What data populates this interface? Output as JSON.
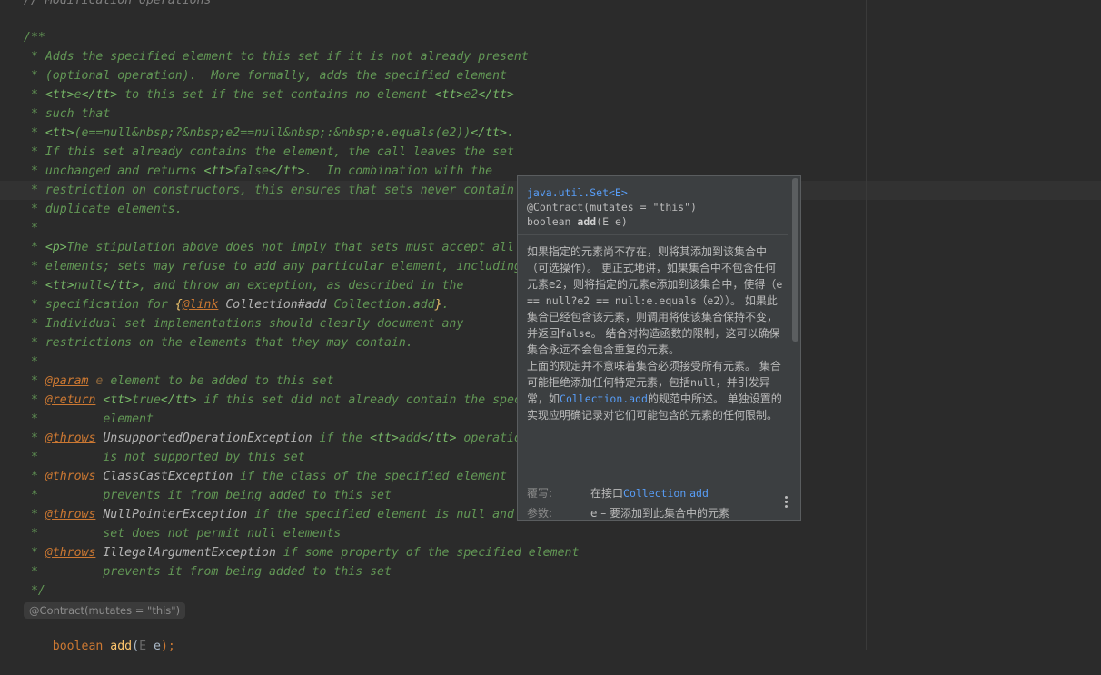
{
  "editor": {
    "cut_line_top": "// Modification Operations",
    "lines": [
      {
        "t": "/**"
      },
      {
        "t": " * Adds the specified element to this set if it is not already present"
      },
      {
        "t": " * (optional operation).  More formally, adds the specified element"
      },
      {
        "t": " * <tt>e</tt> to this set if the set contains no element <tt>e2</tt>"
      },
      {
        "t": " * such that"
      },
      {
        "t": " * <tt>(e==null&nbsp;?&nbsp;e2==null&nbsp;:&nbsp;e.equals(e2))</tt>."
      },
      {
        "t": " * If this set already contains the element, the call leaves the set"
      },
      {
        "t": " * unchanged and returns <tt>false</tt>.  In combination with the"
      },
      {
        "t": " * restriction on constructors, this ensures that sets never contain"
      },
      {
        "t": " * duplicate elements."
      },
      {
        "t": " *"
      },
      {
        "t": " * <p>The stipulation above does not imply that sets must accept all"
      },
      {
        "t": " * elements; sets may refuse to add any particular element, including"
      },
      {
        "t": " * <tt>null</tt>, and throw an exception, as described in the"
      },
      {
        "t": " * specification for {@link Collection#add Collection.add}."
      },
      {
        "t": " * Individual set implementations should clearly document any"
      },
      {
        "t": " * restrictions on the elements that they may contain."
      },
      {
        "t": " *"
      },
      {
        "t": " * @param e element to be added to this set"
      },
      {
        "t": " * @return <tt>true</tt> if this set did not already contain the specified"
      },
      {
        "t": " *         element"
      },
      {
        "t": " * @throws UnsupportedOperationException if the <tt>add</tt> operation"
      },
      {
        "t": " *         is not supported by this set"
      },
      {
        "t": " * @throws ClassCastException if the class of the specified element"
      },
      {
        "t": " *         prevents it from being added to this set"
      },
      {
        "t": " * @throws NullPointerException if the specified element is null and this"
      },
      {
        "t": " *         set does not permit null elements"
      },
      {
        "t": " * @throws IllegalArgumentException if some property of the specified element"
      },
      {
        "t": " *         prevents it from being added to this set"
      },
      {
        "t": " */"
      }
    ],
    "inlay_hint": "@Contract(mutates = \"this\")",
    "signature": {
      "kw": "boolean",
      "name": "add",
      "type": "E",
      "param": "e",
      "end": ");"
    }
  },
  "popup": {
    "package_line": "java.util.Set<E>",
    "contract_line": "@Contract(mutates = \"this\")",
    "sig_prefix": "boolean ",
    "sig_name": "add",
    "sig_suffix": "(E e)",
    "desc": {
      "p1_a": "如果指定的元素尚不存在，则将其添加到该集合中（可选操作）。 更正式地讲，如果集合中不包含任何元素e2，则将指定的元素e添加到该集合中，使得（",
      "p1_code1": "e == null?e2 == null:e.equals（e2）",
      "p1_b": "）。 如果此集合已经包含该元素，则调用将使该集合保持不变，并返回",
      "p1_code2": "false",
      "p1_c": "。 结合对构造函数的限制，这可以确保集合永远不会包含重复的元素。",
      "p2_a": "上面的规定并不意味着集合必须接受所有元素。 集合可能拒绝添加任何特定元素，包括",
      "p2_code": "null",
      "p2_b": "，并引发异常，如",
      "p2_link": "Collection.add",
      "p2_c": "的规范中所述。 单独设置的实现应明确记录对它们可能包含的元素的任何限制。"
    },
    "overrides_label": "覆写:",
    "overrides_prefix": "在接口",
    "overrides_link": "Collection",
    "overrides_method": "add",
    "params_label": "参数:",
    "params_value": "e – 要添加到此集合中的元素",
    "icons": {
      "more": "more-vertical-icon"
    }
  }
}
